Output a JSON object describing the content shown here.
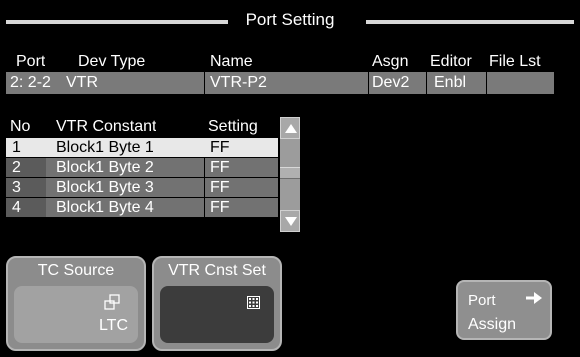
{
  "title": "Port Setting",
  "port_table": {
    "headers": [
      "Port",
      "Dev Type",
      "Name",
      "Asgn",
      "Editor",
      "File Lst"
    ],
    "row": [
      "2: 2-2",
      "VTR",
      "VTR-P2",
      "Dev2",
      "Enbl",
      ""
    ]
  },
  "vtr_table": {
    "headers": [
      "No",
      "VTR Constant",
      "Setting"
    ],
    "rows": [
      [
        "1",
        "Block1 Byte 1",
        "FF"
      ],
      [
        "2",
        "Block1 Byte 2",
        "FF"
      ],
      [
        "3",
        "Block1 Byte 3",
        "FF"
      ],
      [
        "4",
        "Block1 Byte 4",
        "FF"
      ]
    ],
    "selected_index": 0
  },
  "tc_source": {
    "label": "TC Source",
    "value": "LTC",
    "icon": "copy-icon"
  },
  "vtr_cnst_set": {
    "label": "VTR Cnst Set",
    "icon": "keypad-icon"
  },
  "port_assign": {
    "line1": "Port",
    "line2": "Assign",
    "icon": "arrow-right-icon"
  },
  "colors": {
    "selected_row": "#e8e8e8",
    "row": "#727272",
    "port_row": "#7a7a7a",
    "button": "#8c8c8c"
  }
}
